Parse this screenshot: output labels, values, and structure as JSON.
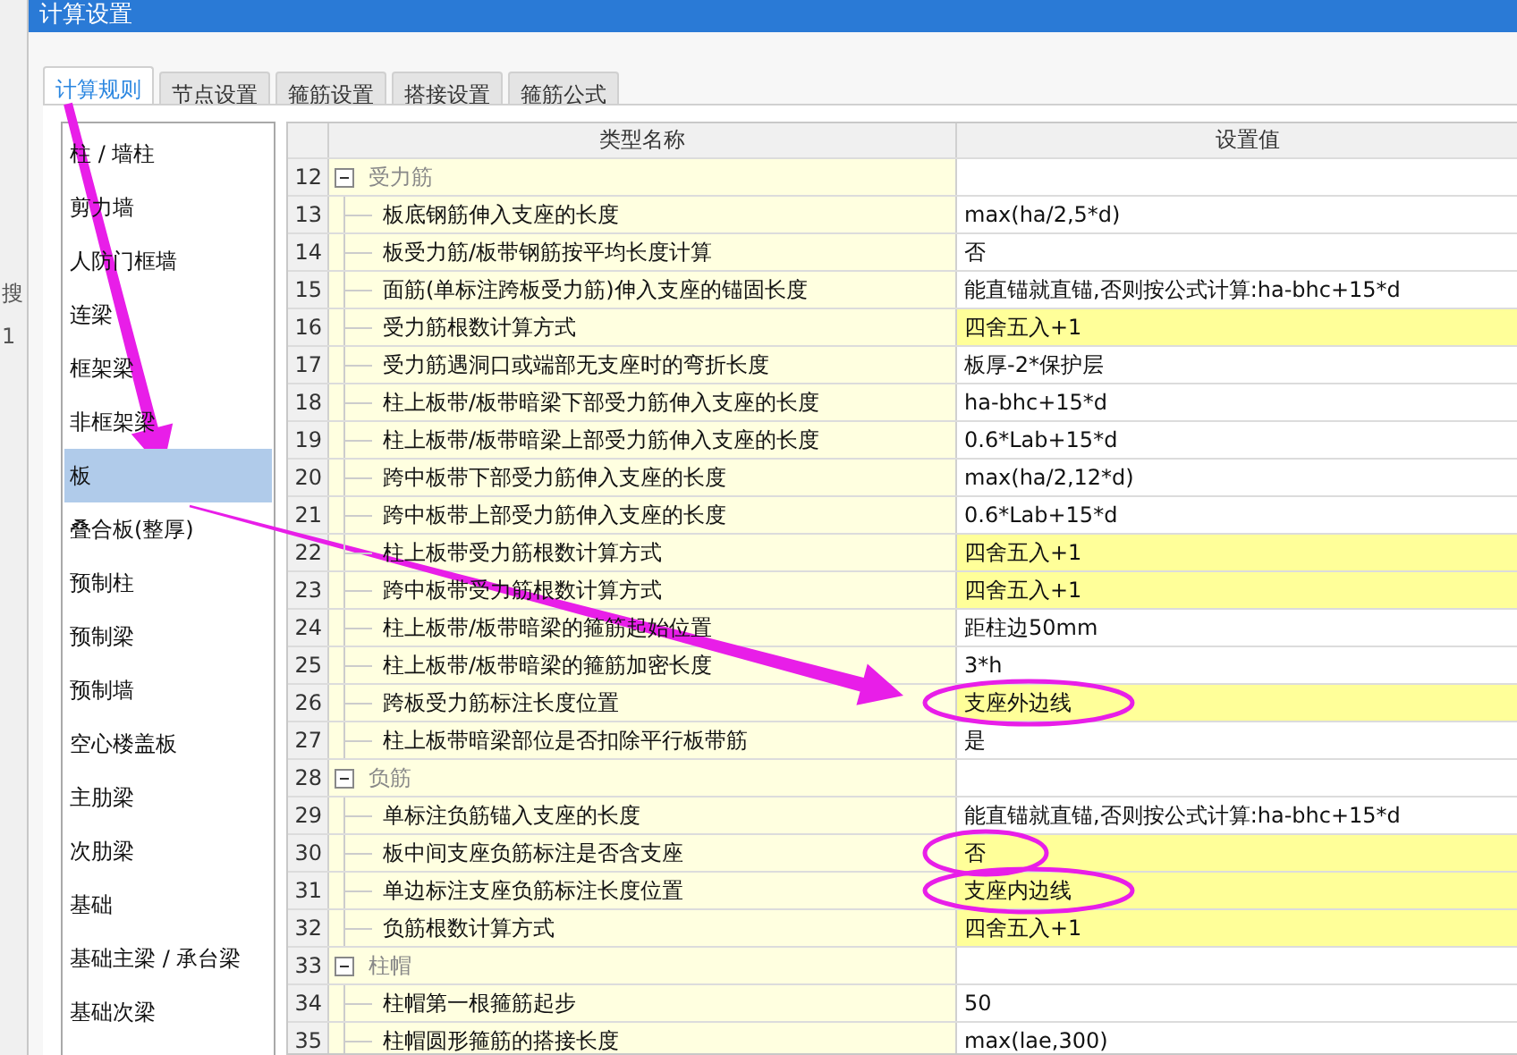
{
  "background_app": {
    "texts": [
      "搜",
      "1"
    ]
  },
  "window": {
    "title": "计算设置"
  },
  "tabs": [
    {
      "label": "计算规则",
      "selected": true
    },
    {
      "label": "节点设置",
      "selected": false
    },
    {
      "label": "箍筋设置",
      "selected": false
    },
    {
      "label": "搭接设置",
      "selected": false
    },
    {
      "label": "箍筋公式",
      "selected": false
    }
  ],
  "sidebar": {
    "items": [
      {
        "label": "柱 / 墙柱",
        "selected": false
      },
      {
        "label": "剪力墙",
        "selected": false
      },
      {
        "label": "人防门框墙",
        "selected": false
      },
      {
        "label": "连梁",
        "selected": false
      },
      {
        "label": "框架梁",
        "selected": false
      },
      {
        "label": "非框架梁",
        "selected": false
      },
      {
        "label": "板",
        "selected": true
      },
      {
        "label": "叠合板(整厚)",
        "selected": false
      },
      {
        "label": "预制柱",
        "selected": false
      },
      {
        "label": "预制梁",
        "selected": false
      },
      {
        "label": "预制墙",
        "selected": false
      },
      {
        "label": "空心楼盖板",
        "selected": false
      },
      {
        "label": "主肋梁",
        "selected": false
      },
      {
        "label": "次肋梁",
        "selected": false
      },
      {
        "label": "基础",
        "selected": false
      },
      {
        "label": "基础主梁 / 承台梁",
        "selected": false
      },
      {
        "label": "基础次梁",
        "selected": false
      }
    ]
  },
  "table": {
    "columns": [
      "类型名称",
      "设置值"
    ],
    "rows": [
      {
        "kind": "group",
        "number": "12",
        "name": "受力筋",
        "expanded": true
      },
      {
        "kind": "setting",
        "number": "13",
        "name": "板底钢筋伸入支座的长度",
        "value": "max(ha/2,5*d)",
        "highlighted": false,
        "circled": false
      },
      {
        "kind": "setting",
        "number": "14",
        "name": "板受力筋/板带钢筋按平均长度计算",
        "value": "否",
        "highlighted": false,
        "circled": false
      },
      {
        "kind": "setting",
        "number": "15",
        "name": "面筋(单标注跨板受力筋)伸入支座的锚固长度",
        "value": "能直锚就直锚,否则按公式计算:ha-bhc+15*d",
        "highlighted": false,
        "circled": false
      },
      {
        "kind": "setting",
        "number": "16",
        "name": "受力筋根数计算方式",
        "value": "四舍五入+1",
        "highlighted": true,
        "circled": false
      },
      {
        "kind": "setting",
        "number": "17",
        "name": "受力筋遇洞口或端部无支座时的弯折长度",
        "value": "板厚-2*保护层",
        "highlighted": false,
        "circled": false
      },
      {
        "kind": "setting",
        "number": "18",
        "name": "柱上板带/板带暗梁下部受力筋伸入支座的长度",
        "value": "ha-bhc+15*d",
        "highlighted": false,
        "circled": false
      },
      {
        "kind": "setting",
        "number": "19",
        "name": "柱上板带/板带暗梁上部受力筋伸入支座的长度",
        "value": "0.6*Lab+15*d",
        "highlighted": false,
        "circled": false
      },
      {
        "kind": "setting",
        "number": "20",
        "name": "跨中板带下部受力筋伸入支座的长度",
        "value": "max(ha/2,12*d)",
        "highlighted": false,
        "circled": false
      },
      {
        "kind": "setting",
        "number": "21",
        "name": "跨中板带上部受力筋伸入支座的长度",
        "value": "0.6*Lab+15*d",
        "highlighted": false,
        "circled": false
      },
      {
        "kind": "setting",
        "number": "22",
        "name": "柱上板带受力筋根数计算方式",
        "value": "四舍五入+1",
        "highlighted": true,
        "circled": false
      },
      {
        "kind": "setting",
        "number": "23",
        "name": "跨中板带受力筋根数计算方式",
        "value": "四舍五入+1",
        "highlighted": true,
        "circled": false
      },
      {
        "kind": "setting",
        "number": "24",
        "name": "柱上板带/板带暗梁的箍筋起始位置",
        "value": "距柱边50mm",
        "highlighted": false,
        "circled": false
      },
      {
        "kind": "setting",
        "number": "25",
        "name": "柱上板带/板带暗梁的箍筋加密长度",
        "value": "3*h",
        "highlighted": false,
        "circled": false
      },
      {
        "kind": "setting",
        "number": "26",
        "name": "跨板受力筋标注长度位置",
        "value": "支座外边线",
        "highlighted": true,
        "circled": true
      },
      {
        "kind": "setting",
        "number": "27",
        "name": "柱上板带暗梁部位是否扣除平行板带筋",
        "value": "是",
        "highlighted": false,
        "circled": false
      },
      {
        "kind": "group",
        "number": "28",
        "name": "负筋",
        "expanded": true
      },
      {
        "kind": "setting",
        "number": "29",
        "name": "单标注负筋锚入支座的长度",
        "value": "能直锚就直锚,否则按公式计算:ha-bhc+15*d",
        "highlighted": false,
        "circled": false
      },
      {
        "kind": "setting",
        "number": "30",
        "name": "板中间支座负筋标注是否含支座",
        "value": "否",
        "highlighted": true,
        "circled": true
      },
      {
        "kind": "setting",
        "number": "31",
        "name": "单边标注支座负筋标注长度位置",
        "value": "支座内边线",
        "highlighted": true,
        "circled": true
      },
      {
        "kind": "setting",
        "number": "32",
        "name": "负筋根数计算方式",
        "value": "四舍五入+1",
        "highlighted": true,
        "circled": false
      },
      {
        "kind": "group",
        "number": "33",
        "name": "柱帽",
        "expanded": true
      },
      {
        "kind": "setting",
        "number": "34",
        "name": "柱帽第一根箍筋起步",
        "value": "50",
        "highlighted": false,
        "circled": false
      },
      {
        "kind": "setting",
        "number": "35",
        "name": "柱帽圆形箍筋的搭接长度",
        "value": "max(lae,300)",
        "highlighted": false,
        "circled": false
      }
    ]
  },
  "annotation_arrows": [
    {
      "kind": "thick"
    },
    {
      "kind": "tapered"
    }
  ]
}
